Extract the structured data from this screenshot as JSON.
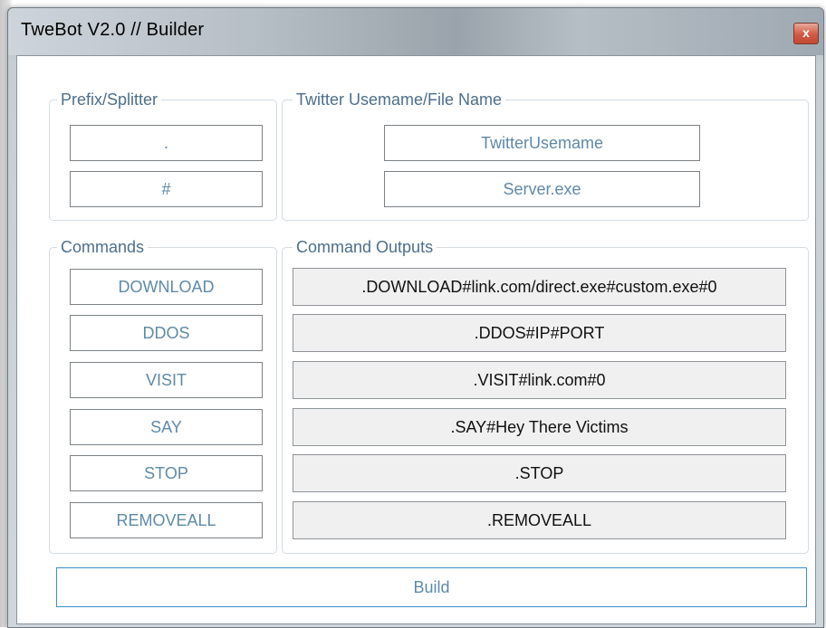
{
  "window": {
    "title": "TweBot V2.0 // Builder",
    "close_glyph": "x"
  },
  "prefix_group": {
    "label": "Prefix/Splitter",
    "prefix_value": ".",
    "splitter_value": "#"
  },
  "twitter_group": {
    "label": "Twitter Usemame/File Name",
    "username_value": "TwitterUsemame",
    "filename_value": "Server.exe"
  },
  "commands_group": {
    "label": "Commands",
    "items": [
      "DOWNLOAD",
      "DDOS",
      "VISIT",
      "SAY",
      "STOP",
      "REMOVEALL"
    ]
  },
  "outputs_group": {
    "label": "Command Outputs",
    "items": [
      ".DOWNLOAD#link.com/direct.exe#custom.exe#0",
      ".DDOS#IP#PORT",
      ".VISIT#link.com#0",
      ".SAY#Hey There Victims",
      ".STOP",
      ".REMOVEALL"
    ]
  },
  "build_button": {
    "label": "Build"
  },
  "colors": {
    "accent_border": "#3c8fc9",
    "field_text": "#5f8aa8",
    "close_red": "#d25a43"
  }
}
